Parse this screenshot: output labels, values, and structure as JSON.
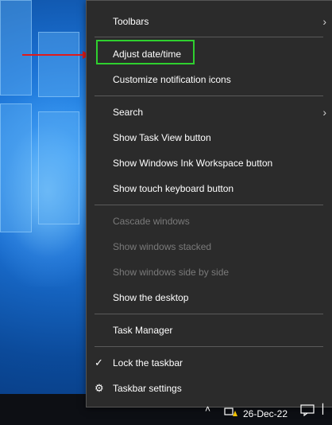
{
  "menu": {
    "items": [
      {
        "label": "Toolbars",
        "submenu": true
      },
      {
        "label": "Adjust date/time"
      },
      {
        "label": "Customize notification icons"
      },
      {
        "label": "Search",
        "submenu": true
      },
      {
        "label": "Show Task View button"
      },
      {
        "label": "Show Windows Ink Workspace button"
      },
      {
        "label": "Show touch keyboard button"
      },
      {
        "label": "Cascade windows",
        "disabled": true
      },
      {
        "label": "Show windows stacked",
        "disabled": true
      },
      {
        "label": "Show windows side by side",
        "disabled": true
      },
      {
        "label": "Show the desktop"
      },
      {
        "label": "Task Manager"
      },
      {
        "label": "Lock the taskbar",
        "checked": true
      },
      {
        "label": "Taskbar settings",
        "icon": "gear-icon"
      }
    ]
  },
  "taskbar": {
    "date": "26-Dec-22"
  },
  "colors": {
    "highlight": "#2fd02f",
    "arrow": "#e01b1b",
    "menu_bg": "#2b2b2b"
  }
}
